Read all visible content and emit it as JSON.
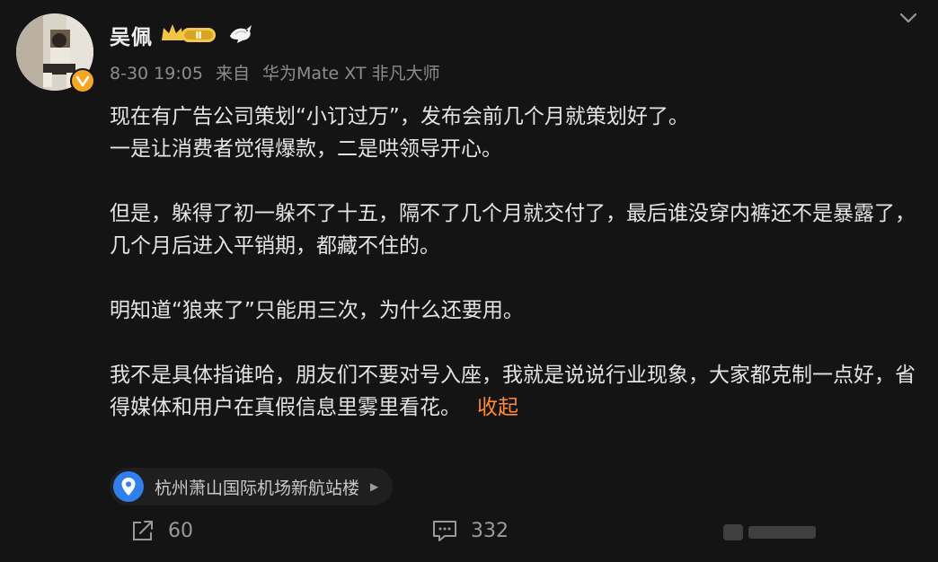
{
  "post": {
    "username": "吴佩",
    "member_badge_level": "Ⅱ",
    "meta": {
      "date": "8-30 19:05",
      "source_prefix": "来自",
      "source_device": "华为Mate XT 非凡大师"
    },
    "paragraphs": [
      "现在有广告公司策划“小订过万”，发布会前几个月就策划好了。",
      "一是让消费者觉得爆款，二是哄领导开心。",
      "但是，躲得了初一躲不了十五，隔不了几个月就交付了，最后谁没穿内裤还不是暴露了，几个月后进入平销期，都藏不住的。",
      "明知道“狼来了”只能用三次，为什么还要用。",
      "我不是具体指谁哈，朋友们不要对号入座，我就是说说行业现象，大家都克制一点好，省得媒体和用户在真假信息里雾里看花。"
    ],
    "collapse_label": "收起",
    "location": "杭州萧山国际机场新航站楼",
    "actions": {
      "share_count": "60",
      "comment_count": "332"
    }
  },
  "icons": {
    "avatar": "avatar-photo",
    "verified": "verified-v-icon",
    "member": "member-crown-badge-icon",
    "dove": "dove-icon",
    "more": "chevron-down-icon",
    "location": "location-pin-icon",
    "share": "share-icon",
    "comment": "comment-icon",
    "like": "like-icon"
  },
  "colors": {
    "background": "#141414",
    "text": "#e4e4e4",
    "meta": "#8d8d8d",
    "link": "#ff8a2e",
    "verified": "#f5a623",
    "location_pin": "#2f80ed"
  }
}
